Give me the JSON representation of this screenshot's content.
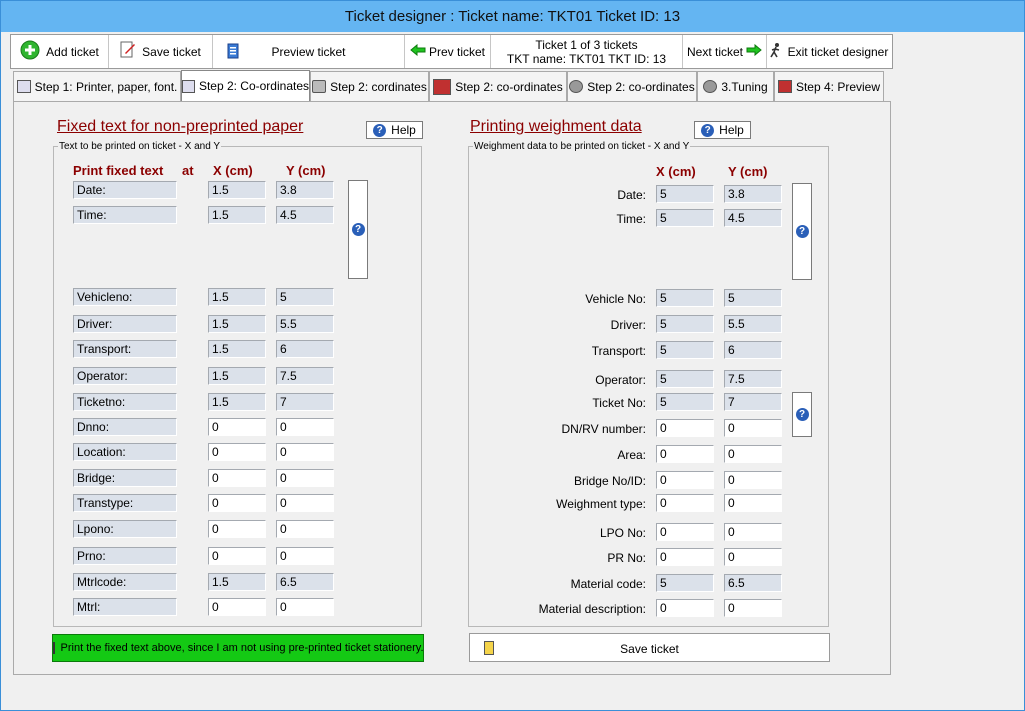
{
  "window": {
    "title": "Ticket designer : Ticket name: TKT01  Ticket ID: 13"
  },
  "toolbar": {
    "add": "Add ticket",
    "save": "Save ticket",
    "preview": "Preview ticket",
    "prev": "Prev ticket",
    "info_line1": "Ticket 1 of 3 tickets",
    "info_line2": "TKT name: TKT01  TKT ID: 13",
    "next": "Next ticket",
    "exit": "Exit ticket designer"
  },
  "tabs": [
    "Step 1: Printer, paper, font.",
    "Step 2: Co-ordinates",
    "Step 2: cordinates",
    "Step 2: co-ordinates",
    "Step 2: co-ordinates",
    "3.Tuning",
    "Step 4: Preview"
  ],
  "left": {
    "heading": "Fixed text for non-preprinted paper",
    "help": "Help",
    "legend": "Text to be printed on ticket - X and Y",
    "col_text": "Print fixed text",
    "col_at": "at",
    "col_x": "X (cm)",
    "col_y": "Y (cm)",
    "rows": [
      {
        "label": "Date:",
        "x": "1.5",
        "y": "3.8"
      },
      {
        "label": "Time:",
        "x": "1.5",
        "y": "4.5"
      },
      {
        "label": "Vehicleno:",
        "x": "1.5",
        "y": "5"
      },
      {
        "label": "Driver:",
        "x": "1.5",
        "y": "5.5"
      },
      {
        "label": "Transport:",
        "x": "1.5",
        "y": "6"
      },
      {
        "label": "Operator:",
        "x": "1.5",
        "y": "7.5"
      },
      {
        "label": "Ticketno:",
        "x": "1.5",
        "y": "7"
      },
      {
        "label": "Dnno:",
        "x": "0",
        "y": "0"
      },
      {
        "label": "Location:",
        "x": "0",
        "y": "0"
      },
      {
        "label": "Bridge:",
        "x": "0",
        "y": "0"
      },
      {
        "label": "Transtype:",
        "x": "0",
        "y": "0"
      },
      {
        "label": "Lpono:",
        "x": "0",
        "y": "0"
      },
      {
        "label": "Prno:",
        "x": "0",
        "y": "0"
      },
      {
        "label": "Mtrlcode:",
        "x": "1.5",
        "y": "6.5"
      },
      {
        "label": "Mtrl:",
        "x": "0",
        "y": "0"
      }
    ],
    "print_button": "Print the fixed text above, since I am not using pre-printed ticket stationery."
  },
  "right": {
    "heading": "Printing weighment data",
    "help": "Help",
    "legend": "Weighment data to be printed on ticket - X and Y",
    "col_x": "X (cm)",
    "col_y": "Y (cm)",
    "rows": [
      {
        "label": "Date:",
        "x": "5",
        "y": "3.8"
      },
      {
        "label": "Time:",
        "x": "5",
        "y": "4.5"
      },
      {
        "label": "Vehicle No:",
        "x": "5",
        "y": "5"
      },
      {
        "label": "Driver:",
        "x": "5",
        "y": "5.5"
      },
      {
        "label": "Transport:",
        "x": "5",
        "y": "6"
      },
      {
        "label": "Operator:",
        "x": "5",
        "y": "7.5"
      },
      {
        "label": "Ticket No:",
        "x": "5",
        "y": "7"
      },
      {
        "label": "DN/RV number:",
        "x": "0",
        "y": "0"
      },
      {
        "label": "Area:",
        "x": "0",
        "y": "0"
      },
      {
        "label": "Bridge No/ID:",
        "x": "0",
        "y": "0"
      },
      {
        "label": "Weighment type:",
        "x": "0",
        "y": "0"
      },
      {
        "label": "LPO No:",
        "x": "0",
        "y": "0"
      },
      {
        "label": "PR No:",
        "x": "0",
        "y": "0"
      },
      {
        "label": "Material code:",
        "x": "5",
        "y": "6.5"
      },
      {
        "label": "Material description:",
        "x": "0",
        "y": "0"
      }
    ],
    "save_button": "Save ticket"
  }
}
